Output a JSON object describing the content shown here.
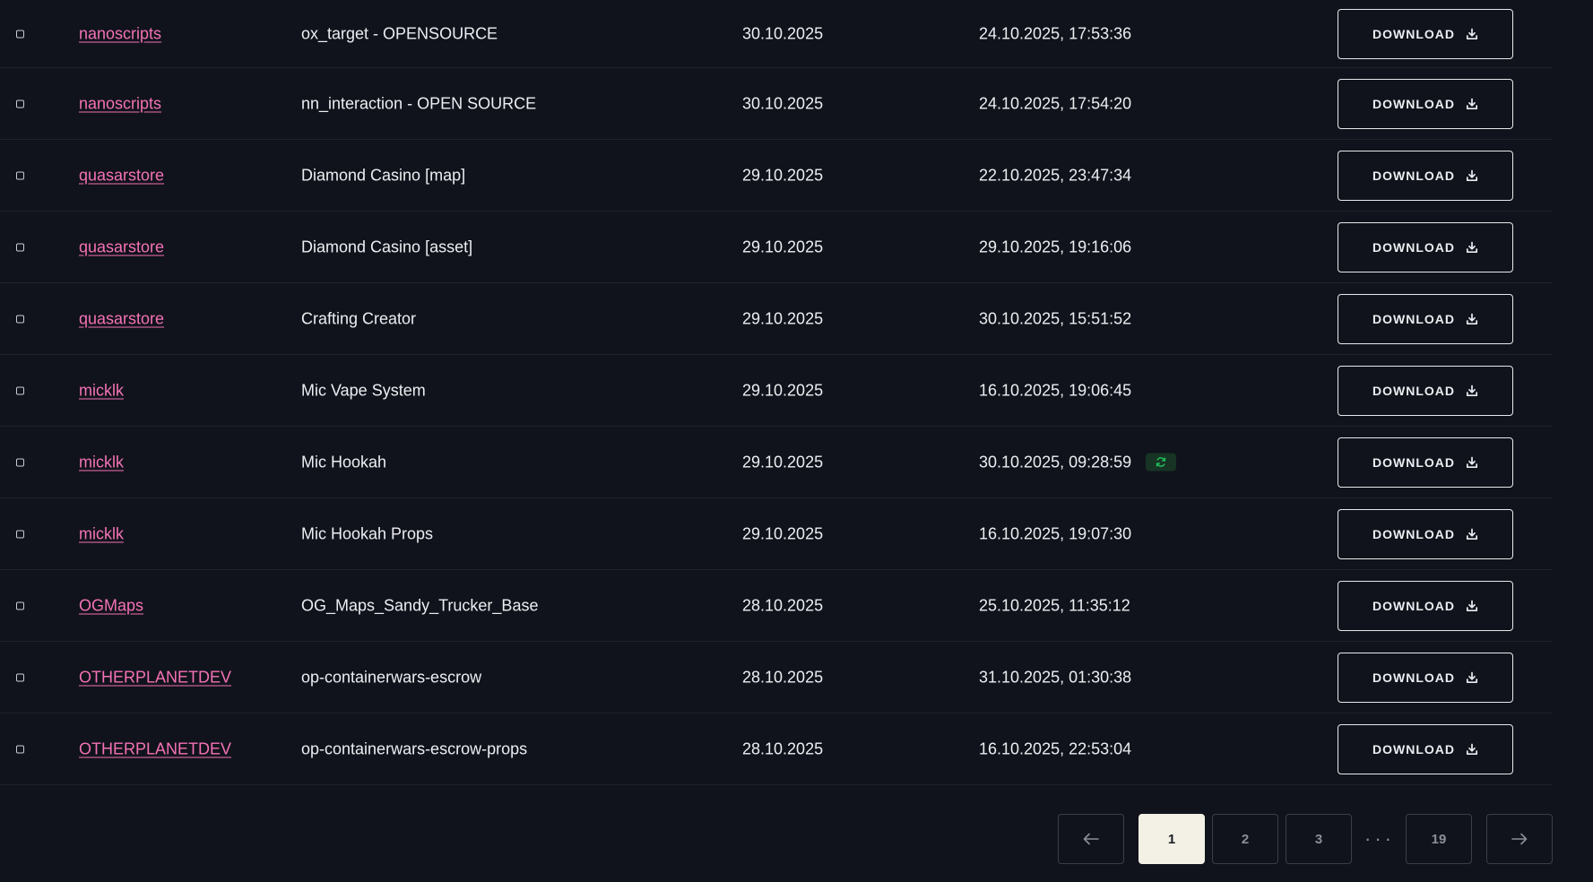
{
  "rows": [
    {
      "author": "nanoscripts",
      "name": "ox_target - OPENSOURCE",
      "date": "30.10.2025",
      "updated": "24.10.2025, 17:53:36",
      "badge": false
    },
    {
      "author": "nanoscripts",
      "name": "nn_interaction - OPEN SOURCE",
      "date": "30.10.2025",
      "updated": "24.10.2025, 17:54:20",
      "badge": false
    },
    {
      "author": "quasarstore",
      "name": "Diamond Casino [map]",
      "date": "29.10.2025",
      "updated": "22.10.2025, 23:47:34",
      "badge": false
    },
    {
      "author": "quasarstore",
      "name": "Diamond Casino [asset]",
      "date": "29.10.2025",
      "updated": "29.10.2025, 19:16:06",
      "badge": false
    },
    {
      "author": "quasarstore",
      "name": "Crafting Creator",
      "date": "29.10.2025",
      "updated": "30.10.2025, 15:51:52",
      "badge": false
    },
    {
      "author": "micklk",
      "name": "Mic Vape System",
      "date": "29.10.2025",
      "updated": "16.10.2025, 19:06:45",
      "badge": false
    },
    {
      "author": "micklk",
      "name": "Mic Hookah",
      "date": "29.10.2025",
      "updated": "30.10.2025, 09:28:59",
      "badge": true
    },
    {
      "author": "micklk",
      "name": "Mic Hookah Props",
      "date": "29.10.2025",
      "updated": "16.10.2025, 19:07:30",
      "badge": false
    },
    {
      "author": "OGMaps",
      "name": "OG_Maps_Sandy_Trucker_Base",
      "date": "28.10.2025",
      "updated": "25.10.2025, 11:35:12",
      "badge": false
    },
    {
      "author": "OTHERPLANETDEV",
      "name": "op-containerwars-escrow",
      "date": "28.10.2025",
      "updated": "31.10.2025, 01:30:38",
      "badge": false
    },
    {
      "author": "OTHERPLANETDEV",
      "name": "op-containerwars-escrow-props",
      "date": "28.10.2025",
      "updated": "16.10.2025, 22:53:04",
      "badge": false
    }
  ],
  "download_label": "DOWNLOAD",
  "icons": {
    "download": "download-icon",
    "refresh": "refresh-icon",
    "prev": "arrow-left-icon",
    "next": "arrow-right-icon"
  },
  "pagination": {
    "pages": [
      "1",
      "2",
      "3"
    ],
    "current": "1",
    "ellipsis": "···",
    "last": "19"
  },
  "colors": {
    "background": "#10131b",
    "author_link": "#f472b6",
    "active_page": "#f3f1e6",
    "badge_bg": "#173424",
    "badge_icon": "#22c55e"
  }
}
